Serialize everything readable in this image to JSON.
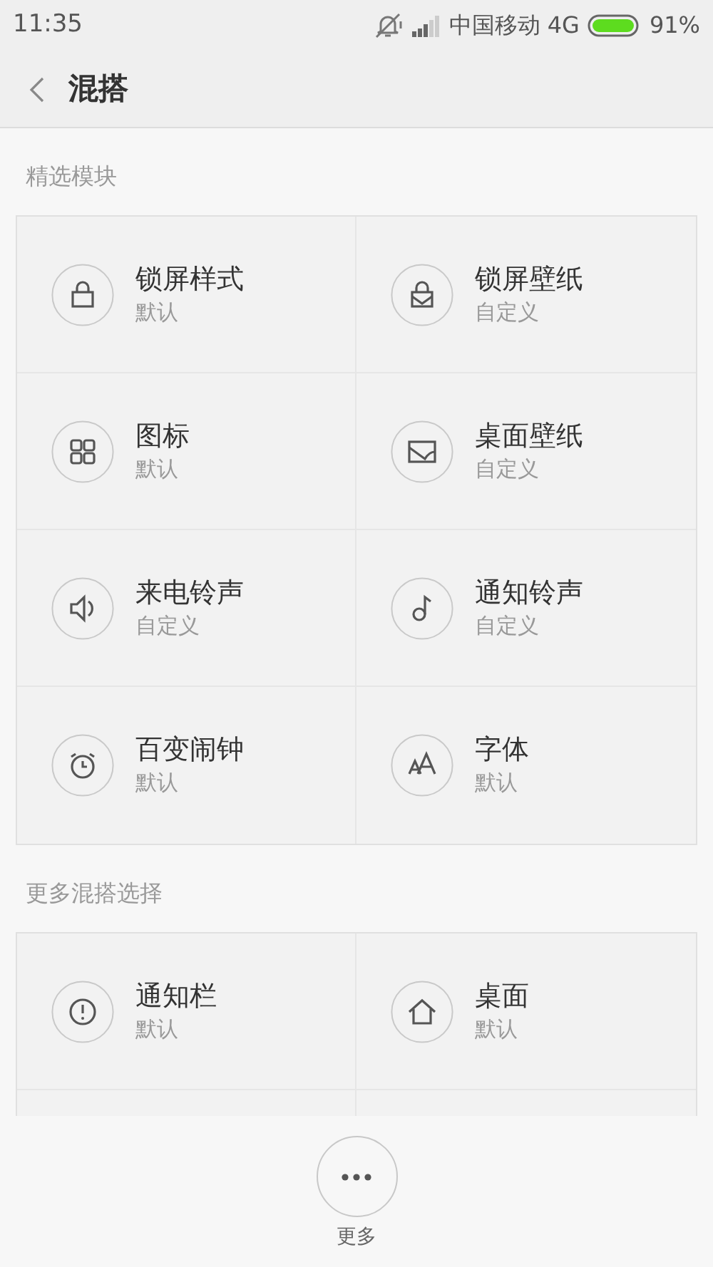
{
  "status_bar": {
    "time": "11:35",
    "carrier": "中国移动 4G",
    "battery": "91%"
  },
  "header": {
    "title": "混搭"
  },
  "sections": [
    {
      "title": "精选模块",
      "tiles": [
        {
          "title": "锁屏样式",
          "subtitle": "默认"
        },
        {
          "title": "锁屏壁纸",
          "subtitle": "自定义"
        },
        {
          "title": "图标",
          "subtitle": "默认"
        },
        {
          "title": "桌面壁纸",
          "subtitle": "自定义"
        },
        {
          "title": "来电铃声",
          "subtitle": "自定义"
        },
        {
          "title": "通知铃声",
          "subtitle": "自定义"
        },
        {
          "title": "百变闹钟",
          "subtitle": "默认"
        },
        {
          "title": "字体",
          "subtitle": "默认"
        }
      ]
    },
    {
      "title": "更多混搭选择",
      "tiles": [
        {
          "title": "通知栏",
          "subtitle": "默认"
        },
        {
          "title": "桌面",
          "subtitle": "默认"
        }
      ]
    }
  ],
  "bottom_action": {
    "label": "更多"
  }
}
